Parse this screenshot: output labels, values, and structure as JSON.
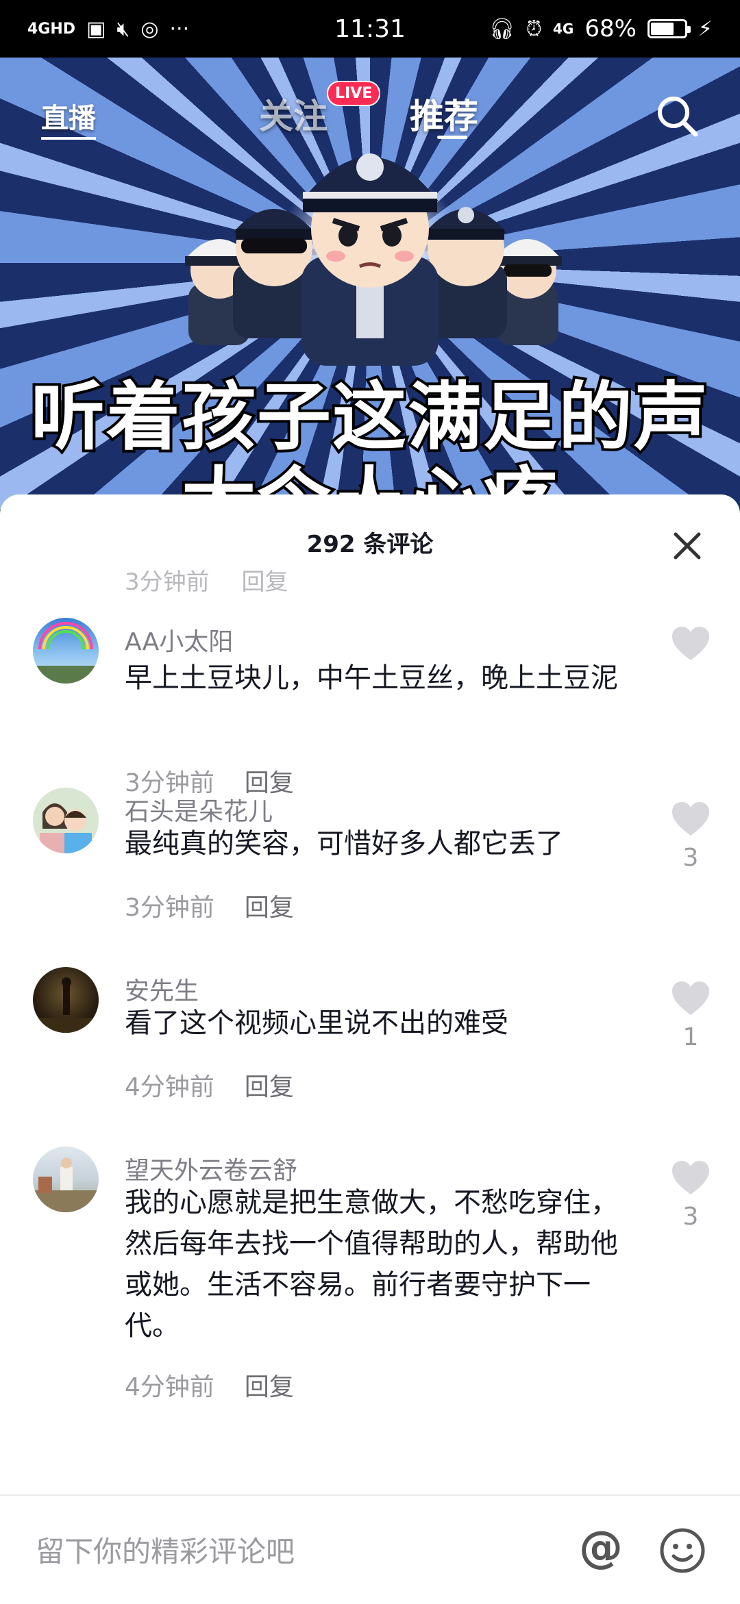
{
  "status_bar": {
    "network": "4GHD",
    "time": "11:31",
    "signal2": "4G",
    "battery_pct": "68%",
    "battery_level": 0.68
  },
  "video": {
    "nav_live": "直播",
    "tab_follow": "关注",
    "live_badge": "LIVE",
    "tab_recommend": "推荐",
    "caption_line1": "听着孩子这满足的声音",
    "caption_line2": "太令人心疼"
  },
  "comments_panel": {
    "title": "292 条评论",
    "partial_time": "3分钟前",
    "partial_reply": "回复",
    "items": [
      {
        "name": "AA小太阳",
        "text": "早上土豆块儿，中午土豆丝，晚上土豆泥",
        "time": "3分钟前",
        "reply": "回复",
        "likes": ""
      },
      {
        "name": "石头是朵花儿",
        "text": "最纯真的笑容，可惜好多人都它丢了",
        "time": "3分钟前",
        "reply": "回复",
        "likes": "3"
      },
      {
        "name": "安先生",
        "text": "看了这个视频心里说不出的难受",
        "time": "4分钟前",
        "reply": "回复",
        "likes": "1"
      },
      {
        "name": "望天外云卷云舒",
        "text": "我的心愿就是把生意做大，不愁吃穿住，然后每年去找一个值得帮助的人，帮助他或她。生活不容易。前行者要守护下一代。",
        "time": "4分钟前",
        "reply": "回复",
        "likes": "3"
      }
    ]
  },
  "input_bar": {
    "placeholder": "留下你的精彩评论吧",
    "at_symbol": "@"
  },
  "colors": {
    "accent": "#fe2c55",
    "like_heart": "#d8d8dc",
    "text_primary": "#161823",
    "text_secondary": "#9a9aa0"
  }
}
